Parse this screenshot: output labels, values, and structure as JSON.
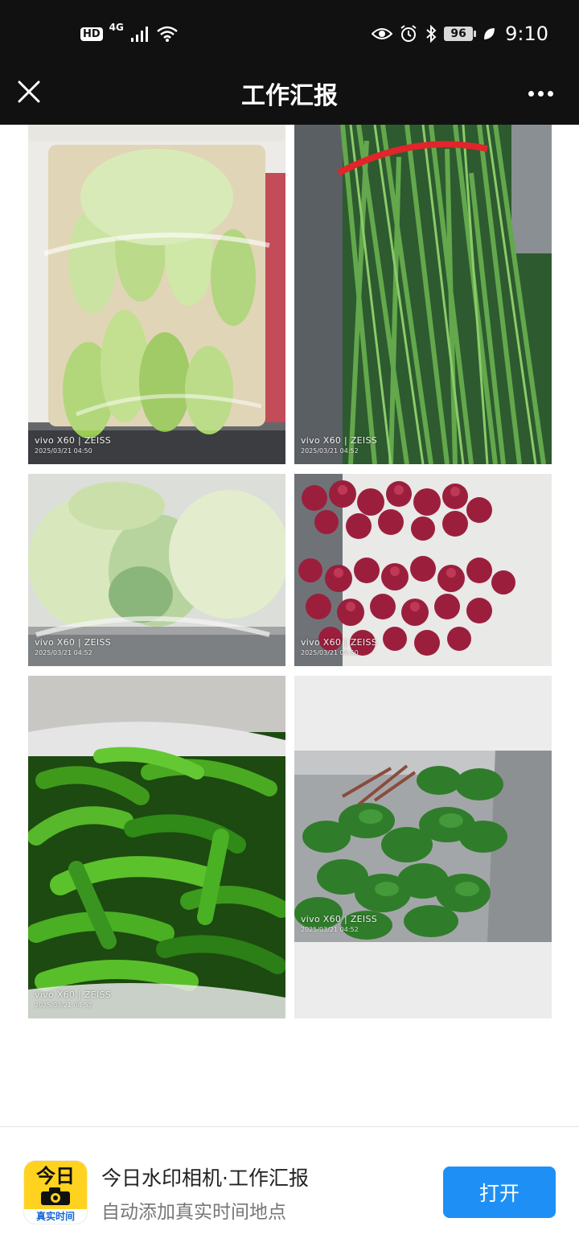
{
  "status_bar": {
    "hd": "HD",
    "network": "4G",
    "battery": "96",
    "time": "9:10"
  },
  "header": {
    "title": "工作汇报"
  },
  "photos": [
    {
      "brand": "vivo X60 | ZEISS",
      "time": "2025/03/21 04:50"
    },
    {
      "brand": "vivo X60 | ZEISS",
      "time": "2025/03/21 04:52"
    },
    {
      "brand": "vivo X60 | ZEISS",
      "time": "2025/03/21 04:52"
    },
    {
      "brand": "vivo X60 | ZEISS",
      "time": "2025/03/21 04:50"
    },
    {
      "brand": "vivo X60 | ZEISS",
      "time": "2025/03/21 04:52"
    },
    {
      "brand": "vivo X60 | ZEISS",
      "time": "2025/03/21 04:52"
    }
  ],
  "banner": {
    "icon_top": "今日",
    "icon_bottom": "真实时间",
    "title": "今日水印相机·工作汇报",
    "subtitle": "自动添加真实时间地点",
    "open_label": "打开"
  },
  "colors": {
    "bar_bg": "#111111",
    "accent": "#1e90f5",
    "icon_yellow": "#ffd21f"
  },
  "icons": [
    "close-icon",
    "more-icon",
    "eye-icon",
    "alarm-icon",
    "bluetooth-icon",
    "signal-icon",
    "wifi-icon",
    "leaf-icon",
    "camera-icon"
  ]
}
